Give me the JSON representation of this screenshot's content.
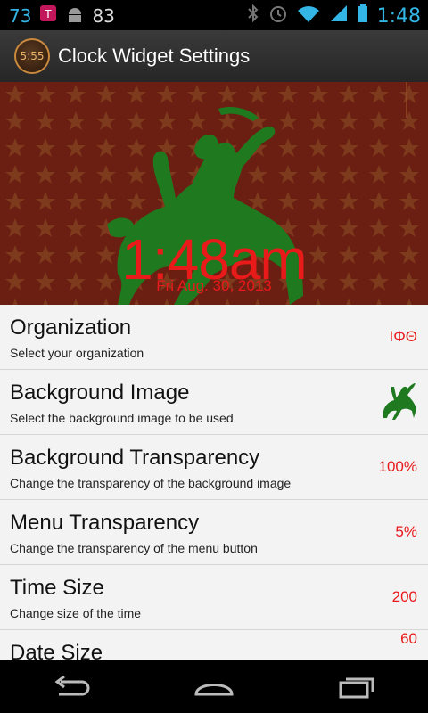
{
  "status_bar": {
    "battery_left": "73",
    "notification_count": "83",
    "time": "1:48",
    "icons": [
      "tmobile-icon",
      "android-icon",
      "bluetooth-icon",
      "alarm-icon",
      "wifi-icon",
      "signal-icon",
      "battery-icon"
    ]
  },
  "action_bar": {
    "app_icon_text": "5:55",
    "title": "Clock Widget Settings"
  },
  "preview": {
    "time": "1:48am",
    "date": "Fri Aug. 30, 2013"
  },
  "settings": [
    {
      "title": "Organization",
      "summary": "Select your organization",
      "value": "ΙΦΘ"
    },
    {
      "title": "Background Image",
      "summary": "Select the background image to be used",
      "value": ""
    },
    {
      "title": "Background Transparency",
      "summary": "Change the transparency of the background image",
      "value": "100%"
    },
    {
      "title": "Menu Transparency",
      "summary": "Change the transparency of the menu button",
      "value": "5%"
    },
    {
      "title": "Time Size",
      "summary": "Change size of the time",
      "value": "200"
    },
    {
      "title": "Date Size",
      "summary": "",
      "value": "60"
    }
  ],
  "colors": {
    "accent": "#e81a1a",
    "status": "#33b5e5",
    "figure": "#1f7a1f"
  },
  "nav": [
    "back-icon",
    "home-icon",
    "recents-icon"
  ]
}
